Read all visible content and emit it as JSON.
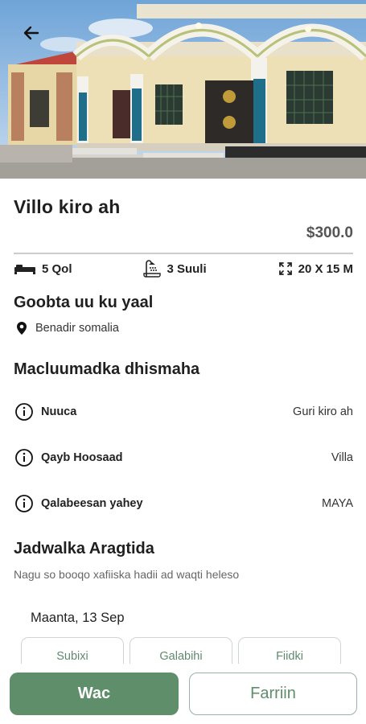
{
  "property": {
    "title": "Villo kiro ah",
    "price": "$300.0"
  },
  "features": [
    {
      "icon": "bed-icon",
      "label": "5 Qol"
    },
    {
      "icon": "shower-icon",
      "label": "3 Suuli"
    },
    {
      "icon": "expand-icon",
      "label": "20 X 15  M"
    }
  ],
  "location": {
    "heading": "Goobta uu ku yaal",
    "address": "Benadir somalia"
  },
  "details": {
    "heading": "Macluumadka dhismaha",
    "rows": [
      {
        "label": "Nuuca",
        "value": "Guri kiro ah"
      },
      {
        "label": "Qayb Hoosaad",
        "value": "Villa"
      },
      {
        "label": "Qalabeesan yahey",
        "value": "MAYA"
      }
    ]
  },
  "schedule": {
    "heading": "Jadwalka Aragtida",
    "subtitle": "Nagu so booqo xafiiska hadii ad waqti heleso",
    "date": "Maanta,  13 Sep",
    "slots": [
      "Subixi",
      "Galabihi",
      "Fiidki"
    ]
  },
  "actions": {
    "call": "Wac",
    "message": "Farriin"
  },
  "colors": {
    "accent": "#5f8e6b",
    "slot_text": "#5f8a6e"
  }
}
